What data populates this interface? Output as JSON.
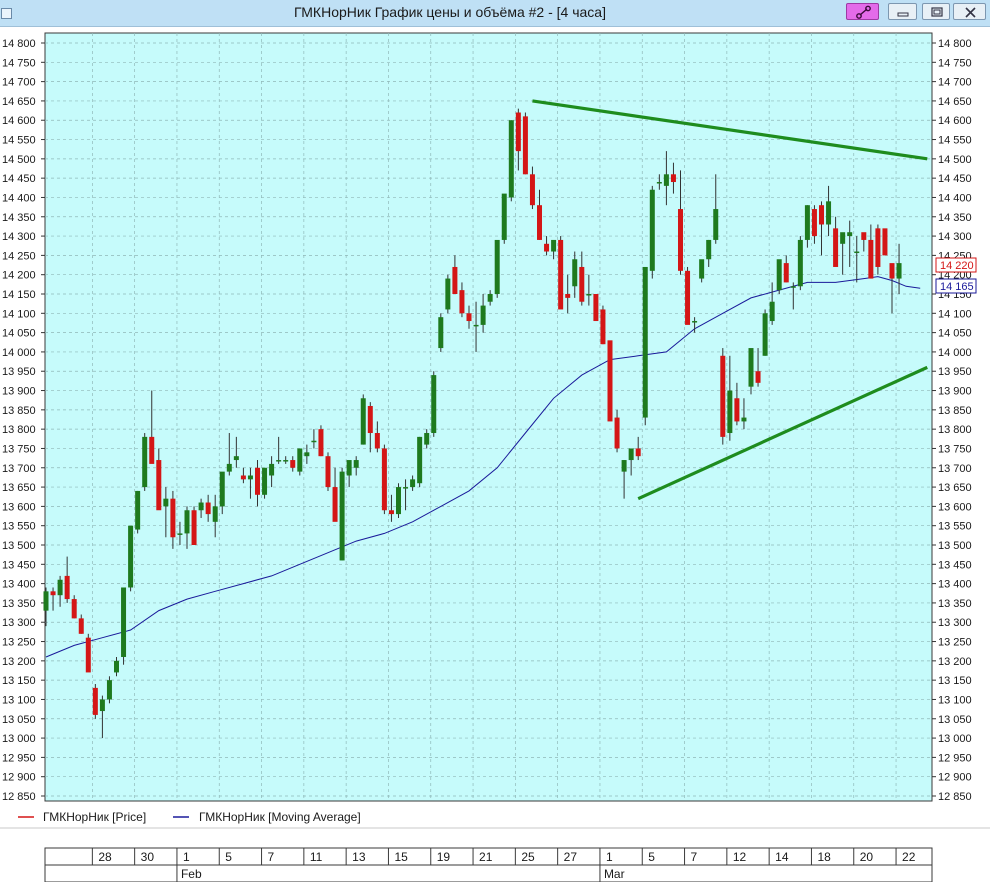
{
  "window": {
    "title": "ГМКНорНик График цены и объёма #2 - [4 часа]"
  },
  "colors": {
    "plot_bg": "#c6fbfb",
    "grid": "#8fb8b8",
    "up": "#1e7a1e",
    "down": "#d41616",
    "ma": "#1a1a9a",
    "trend": "#1e8c1e"
  },
  "legend": {
    "price": "ГМКНорНик [Price]",
    "ma": "ГМКНорНик [Moving Average]"
  },
  "price_tags": {
    "last_price": "14 220",
    "ma_value": "14 165"
  },
  "chart_data": {
    "type": "candlestick",
    "title": "ГМКНорНик График цены и объёма #2 - [4 часа]",
    "timeframe": "4 часа",
    "ylim": [
      12850,
      14800
    ],
    "y_ticks": [
      12850,
      12900,
      12950,
      13000,
      13050,
      13100,
      13150,
      13200,
      13250,
      13300,
      13350,
      13400,
      13450,
      13500,
      13550,
      13600,
      13650,
      13700,
      13750,
      13800,
      13850,
      13900,
      13950,
      14000,
      14050,
      14100,
      14150,
      14200,
      14250,
      14300,
      14350,
      14400,
      14450,
      14500,
      14550,
      14600,
      14650,
      14700,
      14750,
      14800
    ],
    "y_tick_labels": [
      "12 850",
      "12 900",
      "12 950",
      "13 000",
      "13 050",
      "13 100",
      "13 150",
      "13 200",
      "13 250",
      "13 300",
      "13 350",
      "13 400",
      "13 450",
      "13 500",
      "13 550",
      "13 600",
      "13 650",
      "13 700",
      "13 750",
      "13 800",
      "13 850",
      "13 900",
      "13 950",
      "14 000",
      "14 050",
      "14 100",
      "14 150",
      "14 200",
      "14 250",
      "14 300",
      "14 350",
      "14 400",
      "14 450",
      "14 500",
      "14 550",
      "14 600",
      "14 650",
      "14 700",
      "14 750",
      "14 800"
    ],
    "x_day_labels": [
      "28",
      "30",
      "1",
      "5",
      "7",
      "11",
      "13",
      "15",
      "19",
      "21",
      "25",
      "27",
      "1",
      "5",
      "7",
      "12",
      "14",
      "18",
      "20",
      "22"
    ],
    "x_day_candle_index": [
      7,
      13,
      19,
      25,
      31,
      37,
      43,
      49,
      55,
      61,
      67,
      73,
      79,
      85,
      91,
      97,
      103,
      109,
      115,
      121
    ],
    "x_month_labels": [
      {
        "label": "Feb",
        "candle_index": 19
      },
      {
        "label": "Mar",
        "candle_index": 79
      }
    ],
    "series": [
      {
        "name": "ГМКНорНик [Price]",
        "kind": "candle",
        "ohlc": [
          [
            13330,
            13390,
            13290,
            13380
          ],
          [
            13380,
            13390,
            13330,
            13370
          ],
          [
            13370,
            13420,
            13340,
            13410
          ],
          [
            13420,
            13470,
            13350,
            13360
          ],
          [
            13360,
            13370,
            13310,
            13310
          ],
          [
            13310,
            13320,
            13270,
            13270
          ],
          [
            13260,
            13270,
            13180,
            13170
          ],
          [
            13130,
            13140,
            13050,
            13060
          ],
          [
            13070,
            13110,
            13000,
            13100
          ],
          [
            13100,
            13160,
            13090,
            13150
          ],
          [
            13170,
            13210,
            13160,
            13200
          ],
          [
            13210,
            13310,
            13190,
            13390
          ],
          [
            13390,
            13540,
            13380,
            13550
          ],
          [
            13540,
            13640,
            13530,
            13640
          ],
          [
            13650,
            13790,
            13640,
            13780
          ],
          [
            13780,
            13900,
            13730,
            13710
          ],
          [
            13720,
            13750,
            13600,
            13590
          ],
          [
            13600,
            13650,
            13520,
            13620
          ],
          [
            13620,
            13640,
            13490,
            13520
          ],
          [
            13530,
            13560,
            13500,
            13530
          ],
          [
            13530,
            13600,
            13490,
            13590
          ],
          [
            13590,
            13600,
            13500,
            13500
          ],
          [
            13590,
            13620,
            13570,
            13610
          ],
          [
            13610,
            13630,
            13560,
            13580
          ],
          [
            13560,
            13630,
            13520,
            13600
          ],
          [
            13600,
            13680,
            13580,
            13690
          ],
          [
            13690,
            13790,
            13680,
            13710
          ],
          [
            13720,
            13780,
            13700,
            13730
          ],
          [
            13680,
            13700,
            13660,
            13670
          ],
          [
            13670,
            13700,
            13620,
            13680
          ],
          [
            13700,
            13720,
            13600,
            13630
          ],
          [
            13630,
            13700,
            13620,
            13700
          ],
          [
            13680,
            13730,
            13650,
            13710
          ],
          [
            13720,
            13780,
            13710,
            13720
          ],
          [
            13720,
            13730,
            13710,
            13720
          ],
          [
            13720,
            13730,
            13690,
            13700
          ],
          [
            13690,
            13740,
            13680,
            13750
          ],
          [
            13730,
            13760,
            13710,
            13740
          ],
          [
            13770,
            13800,
            13750,
            13770
          ],
          [
            13800,
            13810,
            13730,
            13730
          ],
          [
            13730,
            13740,
            13640,
            13650
          ],
          [
            13650,
            13700,
            13580,
            13560
          ],
          [
            13460,
            13700,
            13460,
            13690
          ],
          [
            13680,
            13710,
            13650,
            13720
          ],
          [
            13700,
            13730,
            13680,
            13720
          ],
          [
            13760,
            13890,
            13760,
            13880
          ],
          [
            13860,
            13870,
            13740,
            13790
          ],
          [
            13790,
            13820,
            13740,
            13750
          ],
          [
            13750,
            13760,
            13580,
            13590
          ],
          [
            13590,
            13630,
            13560,
            13580
          ],
          [
            13580,
            13660,
            13570,
            13650
          ],
          [
            13650,
            13670,
            13590,
            13650
          ],
          [
            13650,
            13680,
            13640,
            13670
          ],
          [
            13660,
            13780,
            13650,
            13780
          ],
          [
            13760,
            13800,
            13750,
            13790
          ],
          [
            13790,
            13950,
            13780,
            13940
          ],
          [
            14010,
            14100,
            14000,
            14090
          ],
          [
            14110,
            14200,
            14100,
            14190
          ],
          [
            14220,
            14250,
            14150,
            14150
          ],
          [
            14160,
            14180,
            14090,
            14100
          ],
          [
            14100,
            14120,
            14060,
            14080
          ],
          [
            14070,
            14130,
            14000,
            14070
          ],
          [
            14070,
            14150,
            14050,
            14120
          ],
          [
            14130,
            14160,
            14120,
            14150
          ],
          [
            14150,
            14280,
            14140,
            14290
          ],
          [
            14290,
            14400,
            14280,
            14410
          ],
          [
            14400,
            14600,
            14390,
            14600
          ],
          [
            14620,
            14630,
            14470,
            14520
          ],
          [
            14610,
            14620,
            14460,
            14460
          ],
          [
            14460,
            14480,
            14370,
            14380
          ],
          [
            14380,
            14420,
            14290,
            14290
          ],
          [
            14280,
            14300,
            14250,
            14260
          ],
          [
            14260,
            14270,
            14240,
            14290
          ],
          [
            14290,
            14300,
            14130,
            14110
          ],
          [
            14150,
            14200,
            14100,
            14140
          ],
          [
            14170,
            14260,
            14140,
            14240
          ],
          [
            14220,
            14260,
            14120,
            14130
          ],
          [
            14150,
            14200,
            14120,
            14150
          ],
          [
            14150,
            14150,
            14100,
            14080
          ],
          [
            14110,
            14120,
            14020,
            14020
          ],
          [
            14030,
            13990,
            13910,
            13820
          ],
          [
            13830,
            13850,
            13740,
            13750
          ],
          [
            13690,
            13720,
            13620,
            13720
          ],
          [
            13720,
            13740,
            13680,
            13750
          ],
          [
            13750,
            13780,
            13720,
            13730
          ],
          [
            13830,
            14220,
            13810,
            14220
          ],
          [
            14210,
            14430,
            14190,
            14420
          ],
          [
            14440,
            14460,
            14420,
            14440
          ],
          [
            14430,
            14520,
            14380,
            14460
          ],
          [
            14460,
            14490,
            14410,
            14440
          ],
          [
            14370,
            14470,
            14200,
            14210
          ],
          [
            14210,
            14220,
            14120,
            14070
          ],
          [
            14080,
            14090,
            14050,
            14080
          ],
          [
            14190,
            14230,
            14180,
            14240
          ],
          [
            14240,
            14290,
            14220,
            14290
          ],
          [
            14290,
            14460,
            14280,
            14370
          ],
          [
            13990,
            14010,
            13760,
            13780
          ],
          [
            13790,
            13990,
            13770,
            13900
          ],
          [
            13880,
            13920,
            13810,
            13820
          ],
          [
            13820,
            13880,
            13800,
            13830
          ],
          [
            13910,
            14000,
            13890,
            14010
          ],
          [
            13950,
            14010,
            13910,
            13920
          ],
          [
            13990,
            14110,
            13990,
            14100
          ],
          [
            14080,
            14180,
            14070,
            14130
          ],
          [
            14160,
            14230,
            14150,
            14240
          ],
          [
            14230,
            14250,
            14180,
            14180
          ],
          [
            14170,
            14180,
            14110,
            14170
          ],
          [
            14170,
            14300,
            14160,
            14290
          ],
          [
            14290,
            14380,
            14270,
            14380
          ],
          [
            14370,
            14380,
            14280,
            14300
          ],
          [
            14380,
            14390,
            14250,
            14330
          ],
          [
            14330,
            14430,
            14300,
            14390
          ],
          [
            14320,
            14350,
            14240,
            14220
          ],
          [
            14280,
            14300,
            14200,
            14310
          ],
          [
            14300,
            14340,
            14220,
            14310
          ],
          [
            14260,
            14300,
            14180,
            14260
          ],
          [
            14310,
            14300,
            14260,
            14290
          ],
          [
            14290,
            14330,
            14190,
            14190
          ],
          [
            14320,
            14330,
            14200,
            14220
          ],
          [
            14320,
            14310,
            14280,
            14250
          ],
          [
            14230,
            14220,
            14100,
            14190
          ],
          [
            14190,
            14280,
            14150,
            14230
          ]
        ]
      },
      {
        "name": "ГМКНорНик [Moving Average]",
        "kind": "line",
        "points": [
          [
            0,
            13210
          ],
          [
            4,
            13240
          ],
          [
            8,
            13260
          ],
          [
            12,
            13280
          ],
          [
            16,
            13330
          ],
          [
            20,
            13360
          ],
          [
            24,
            13380
          ],
          [
            28,
            13400
          ],
          [
            32,
            13420
          ],
          [
            36,
            13450
          ],
          [
            40,
            13480
          ],
          [
            44,
            13510
          ],
          [
            48,
            13530
          ],
          [
            52,
            13560
          ],
          [
            56,
            13600
          ],
          [
            60,
            13640
          ],
          [
            64,
            13700
          ],
          [
            68,
            13790
          ],
          [
            72,
            13880
          ],
          [
            76,
            13940
          ],
          [
            80,
            13980
          ],
          [
            84,
            13990
          ],
          [
            88,
            14000
          ],
          [
            92,
            14060
          ],
          [
            96,
            14100
          ],
          [
            100,
            14140
          ],
          [
            104,
            14160
          ],
          [
            108,
            14180
          ],
          [
            112,
            14180
          ],
          [
            116,
            14190
          ],
          [
            118,
            14195
          ],
          [
            120,
            14185
          ],
          [
            122,
            14170
          ],
          [
            124,
            14165
          ]
        ]
      }
    ],
    "trendlines": [
      {
        "from": [
          69,
          14650
        ],
        "to": [
          125,
          14500
        ]
      },
      {
        "from": [
          84,
          13620
        ],
        "to": [
          125,
          13960
        ]
      }
    ]
  }
}
